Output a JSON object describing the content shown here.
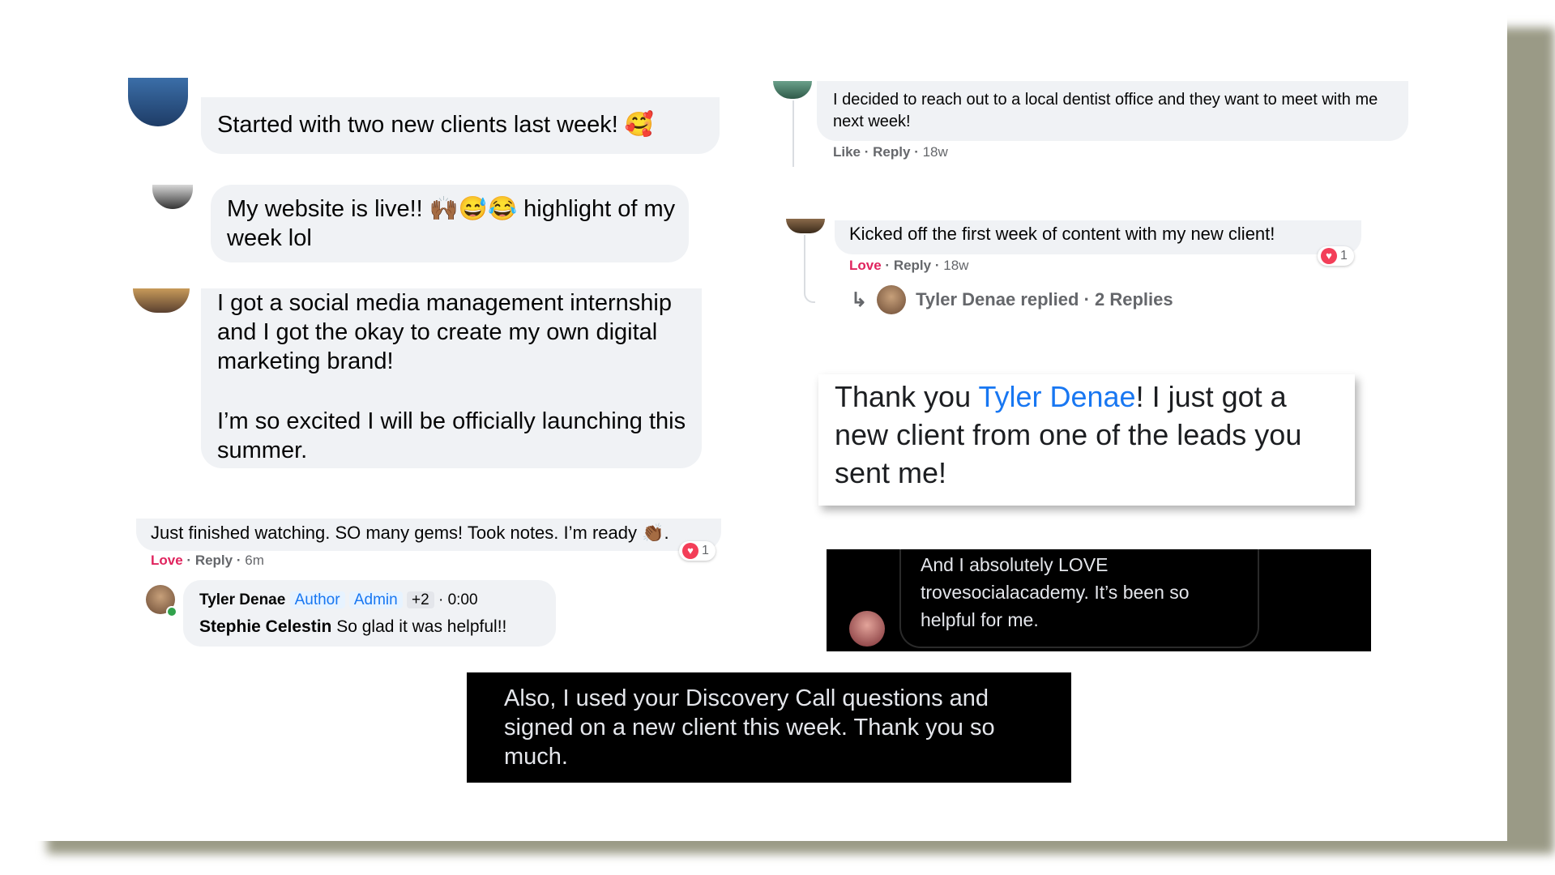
{
  "comments": {
    "c1": {
      "text": "Started with two new clients last week! 🥰"
    },
    "c2": {
      "text": "My website is live!! 🙌🏾😅😂 highlight of my week lol"
    },
    "c3": {
      "para1": "I got a social media management internship and I got the okay to create my own digital marketing brand!",
      "para2": "I’m so excited I will be officially launching this summer."
    },
    "c4": {
      "text": "Just finished watching. SO many gems! Took notes. I’m ready 👏🏾.",
      "love": "Love",
      "reply": "Reply",
      "time": "6m",
      "reaction_count": "1",
      "reply_author": "Tyler Denae",
      "badge_author": "Author",
      "badge_admin": "Admin",
      "badge_more": "+2",
      "reply_time": "0:00",
      "reply_mention": "Stephie Celestin",
      "reply_text": "So glad it was helpful!!"
    },
    "c5": {
      "text": "I decided to reach out to a local dentist office and they want to meet with me next week!",
      "like": "Like",
      "reply": "Reply",
      "time": "18w"
    },
    "c6": {
      "text": "Kicked off the first week of content with my new client!",
      "love": "Love",
      "reply": "Reply",
      "time": "18w",
      "reaction_count": "1",
      "replied_line": "Tyler Denae replied · 2 Replies"
    },
    "c7": {
      "prefix": "Thank you ",
      "mention": "Tyler Denae",
      "suffix": "! I just got a new client from one of the leads you sent me!"
    },
    "c8": {
      "text": "And I absolutely LOVE trovesocialacademy. It’s been so helpful for me."
    },
    "c9": {
      "text": "Also, I used your Discovery Call questions and signed on a new client this week. Thank you so much."
    }
  },
  "colors": {
    "bubble": "#f0f2f5",
    "love": "#e0245e",
    "link": "#1877f2",
    "frame_shadow": "#9a9a86"
  }
}
